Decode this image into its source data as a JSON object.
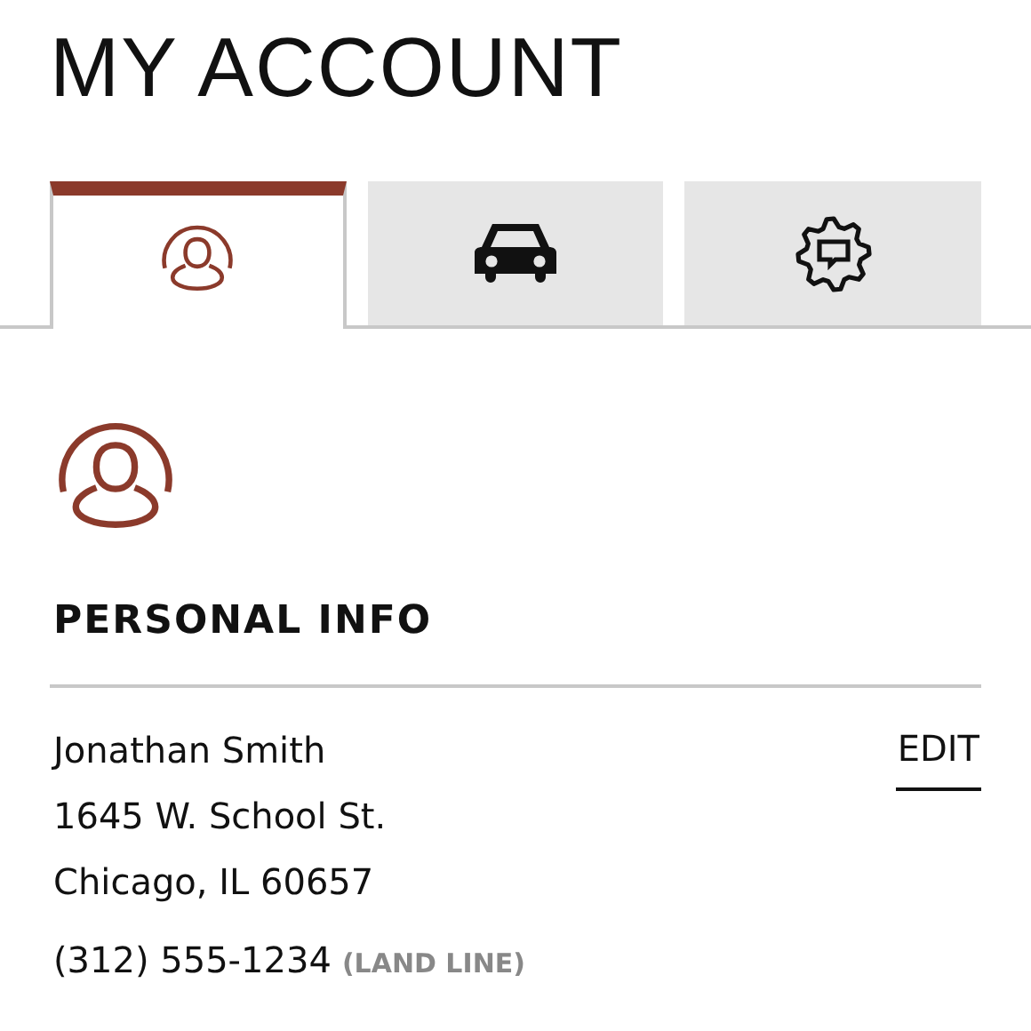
{
  "title": "MY ACCOUNT",
  "tabs": [
    {
      "kind": "person",
      "selected": true
    },
    {
      "kind": "car",
      "selected": false
    },
    {
      "kind": "gear",
      "selected": false
    }
  ],
  "section": {
    "heading": "PERSONAL INFO",
    "name": "Jonathan Smith",
    "edit": "EDIT",
    "address": [
      "1645 W. School St.",
      "Chicago, IL 60657"
    ],
    "phone": "(312) 555-1234",
    "phone_type": "(LAND LINE)"
  }
}
